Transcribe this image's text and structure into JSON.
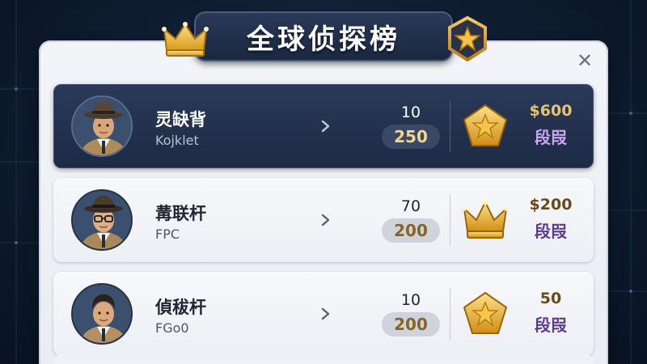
{
  "header": {
    "title": "全球侦探榜",
    "crown_icon": "crown-icon",
    "badge_icon": "star-badge-icon",
    "close_label": "✕"
  },
  "colors": {
    "highlight_row": "#1d2a44",
    "gold": "#e9b84a",
    "rank_purple": "#5b3c8a"
  },
  "rows": [
    {
      "name": "灵缺背",
      "handle": "Kojklet",
      "score_top": "10",
      "score_main": "250",
      "prize": "$600",
      "rank_label": "段叚",
      "reward_icon": "star-pentagon-icon",
      "highlighted": true
    },
    {
      "name": "冓联杆",
      "handle": "FPC",
      "score_top": "70",
      "score_main": "200",
      "prize": "$200",
      "rank_label": "段叚",
      "reward_icon": "crown-icon",
      "highlighted": false
    },
    {
      "name": "偵秡杆",
      "handle": "FGo0",
      "score_top": "10",
      "score_main": "200",
      "prize": "50",
      "rank_label": "段叚",
      "reward_icon": "star-pentagon-icon",
      "highlighted": false
    }
  ]
}
